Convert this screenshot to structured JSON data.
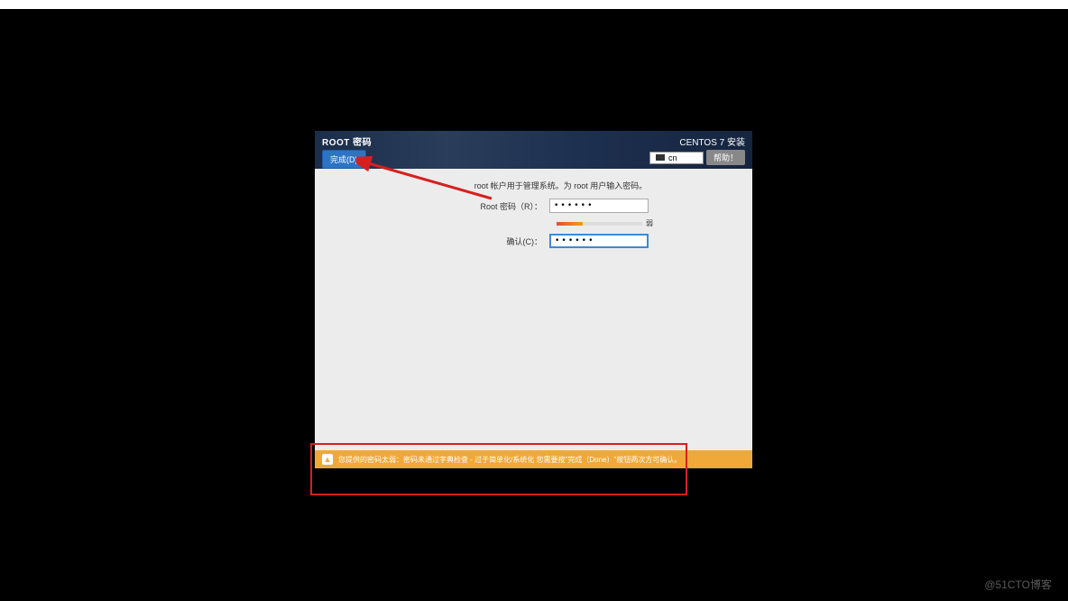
{
  "header": {
    "title": "ROOT 密码",
    "done_btn": "完成(D)",
    "install_title": "CENTOS 7 安装",
    "keyboard": "cn",
    "help_btn": "帮助！"
  },
  "form": {
    "description": "root 帐户用于管理系统。为 root 用户输入密码。",
    "password_label": "Root 密码（R）：",
    "password_value": "••••••",
    "confirm_label": "确认(C)：",
    "confirm_value": "••••••",
    "strength_label": "弱"
  },
  "warning": {
    "text": "您提供的密码太弱：密码未通过字典检查 - 过于简单化/系统化 您需要按\"完成（Done）\"按钮两次方可确认。"
  },
  "watermark": "@51CTO博客"
}
